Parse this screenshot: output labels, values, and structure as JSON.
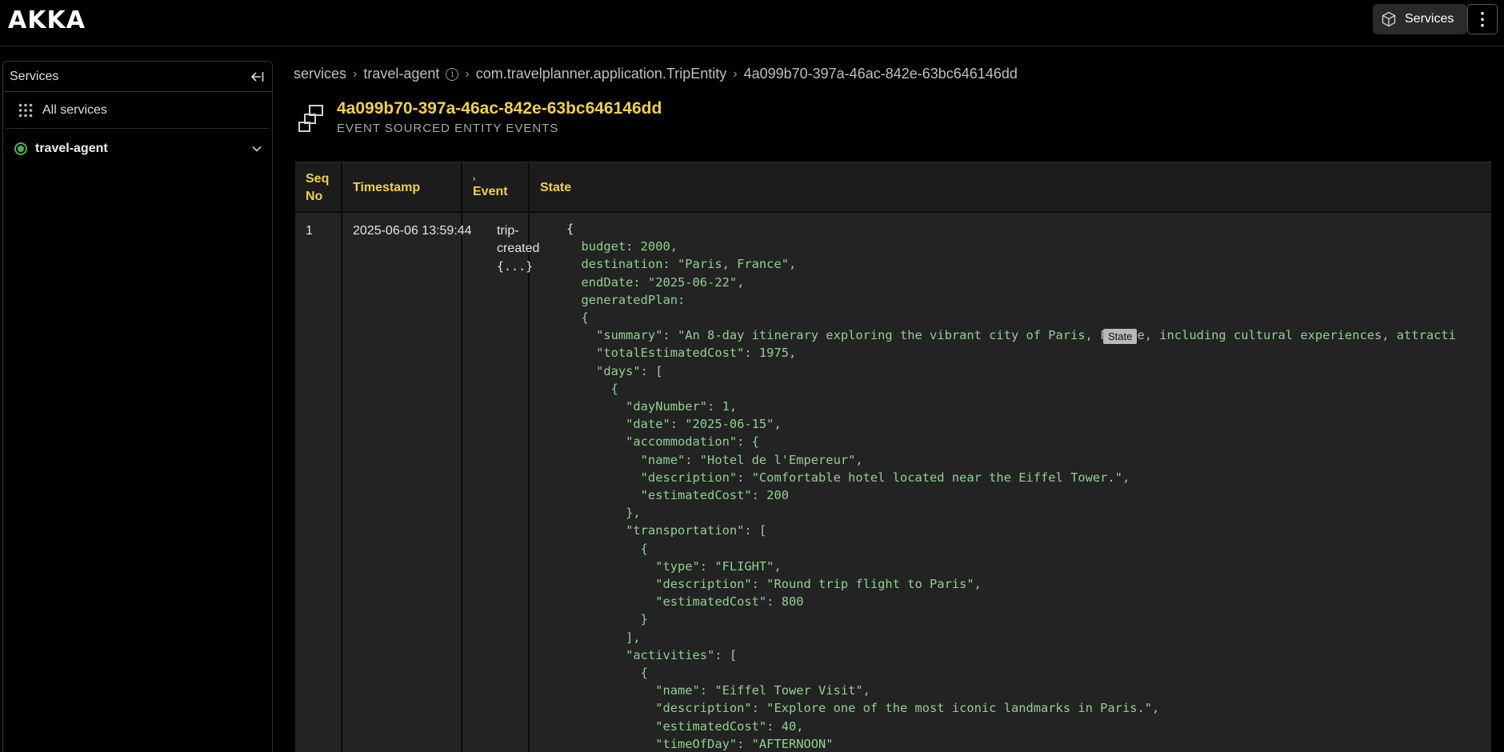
{
  "app": {
    "logo": "AKKA"
  },
  "topbar": {
    "services_label": "Services",
    "more_label": "⋮"
  },
  "sidebar": {
    "title": "Services",
    "all_services": "All services",
    "items": [
      {
        "label": "travel-agent",
        "status": "running"
      }
    ]
  },
  "breadcrumb": {
    "items": [
      "services",
      "travel-agent",
      "com.travelplanner.application.TripEntity",
      "4a099b70-397a-46ac-842e-63bc646146dd"
    ]
  },
  "entity": {
    "id": "4a099b70-397a-46ac-842e-63bc646146dd",
    "subtitle": "EVENT SOURCED ENTITY EVENTS"
  },
  "table": {
    "headers": {
      "seq_no_line1": "Seq",
      "seq_no_line2": "No",
      "timestamp": "Timestamp",
      "event_marker": "›",
      "event": "Event",
      "state": "State"
    },
    "rows": [
      {
        "seq_no": "1",
        "timestamp": "2025-06-06 13:59:44",
        "event_line1": "trip-",
        "event_line2": "created",
        "event_collapsed": "{...}",
        "state_lines": [
          "{",
          "  budget: 2000,",
          "  destination: \"Paris, France\",",
          "  endDate: \"2025-06-22\",",
          "  generatedPlan:",
          "  {",
          "    \"summary\": \"An 8-day itinerary exploring the vibrant city of Paris, France, including cultural experiences, attracti",
          "    \"totalEstimatedCost\": 1975,",
          "    \"days\": [",
          "      {",
          "        \"dayNumber\": 1,",
          "        \"date\": \"2025-06-15\",",
          "        \"accommodation\": {",
          "          \"name\": \"Hotel de l'Empereur\",",
          "          \"description\": \"Comfortable hotel located near the Eiffel Tower.\",",
          "          \"estimatedCost\": 200",
          "        },",
          "        \"transportation\": [",
          "          {",
          "            \"type\": \"FLIGHT\",",
          "            \"description\": \"Round trip flight to Paris\",",
          "            \"estimatedCost\": 800",
          "          }",
          "        ],",
          "        \"activities\": [",
          "          {",
          "            \"name\": \"Eiffel Tower Visit\",",
          "            \"description\": \"Explore one of the most iconic landmarks in Paris.\",",
          "            \"estimatedCost\": 40,",
          "            \"timeOfDay\": \"AFTERNOON\""
        ]
      }
    ],
    "tooltip": "State"
  }
}
